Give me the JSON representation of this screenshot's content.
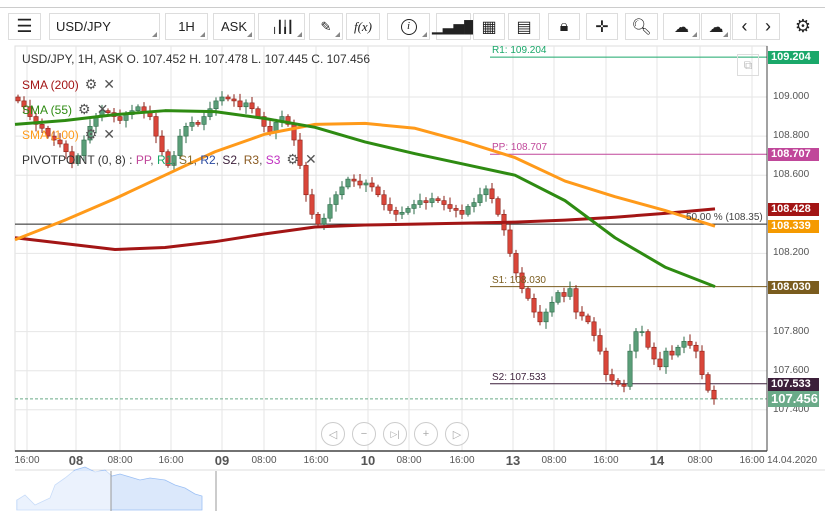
{
  "toolbar": {
    "symbol": "USD/JPY",
    "timeframe": "1H",
    "price_side": "ASK",
    "icons": [
      "menu-icon",
      "candlestick-icon",
      "pencil-icon",
      "function-icon",
      "info-icon",
      "bar-chart-icon",
      "calendar-icon",
      "news-icon",
      "lock-icon",
      "crosshair-icon",
      "zoom-chart-icon",
      "upload-icon",
      "download-icon",
      "chevron-left-icon",
      "chevron-right-icon",
      "gear-icon"
    ],
    "fx": "f(x)",
    "info": "i"
  },
  "legend": {
    "ohlc": "USD/JPY, 1H, ASK   O. 107.452 H. 107.478 L. 107.445 C. 107.456",
    "sma200": "SMA (200)",
    "sma55": "SMA (55)",
    "sma100": "SMA (100)",
    "pivot": "PIVOTPOINT (0, 8)",
    "pivot_sep": " : ",
    "pivot_items": [
      {
        "t": "PP",
        "c": "#c0479a"
      },
      {
        "t": ", ",
        "c": "#555"
      },
      {
        "t": "R1",
        "c": "#1aa86a"
      },
      {
        "t": ", ",
        "c": "#555"
      },
      {
        "t": "S1",
        "c": "#8a6d2a"
      },
      {
        "t": ", ",
        "c": "#555"
      },
      {
        "t": "R2",
        "c": "#2a4aa0"
      },
      {
        "t": ", ",
        "c": "#555"
      },
      {
        "t": "S2",
        "c": "#3c1f3a"
      },
      {
        "t": ", ",
        "c": "#555"
      },
      {
        "t": "R3",
        "c": "#8a5a20"
      },
      {
        "t": ", ",
        "c": "#555"
      },
      {
        "t": "S3",
        "c": "#c030c0"
      }
    ]
  },
  "chart_data": {
    "type": "candlestick",
    "y_ticks": [
      "109.000",
      "108.800",
      "108.600",
      "108.200",
      "107.800",
      "107.600",
      "107.400"
    ],
    "y_tick_values": [
      109.0,
      108.8,
      108.6,
      108.2,
      107.8,
      107.6,
      107.4
    ],
    "x_ticks": [
      {
        "t": "16:00",
        "d": false
      },
      {
        "t": "08",
        "d": true
      },
      {
        "t": "08:00",
        "d": false
      },
      {
        "t": "16:00",
        "d": false
      },
      {
        "t": "09",
        "d": true
      },
      {
        "t": "08:00",
        "d": false
      },
      {
        "t": "16:00",
        "d": false
      },
      {
        "t": "10",
        "d": true
      },
      {
        "t": "08:00",
        "d": false
      },
      {
        "t": "16:00",
        "d": false
      },
      {
        "t": "13",
        "d": true
      },
      {
        "t": "08:00",
        "d": false
      },
      {
        "t": "16:00",
        "d": false
      },
      {
        "t": "14",
        "d": true
      },
      {
        "t": "08:00",
        "d": false
      },
      {
        "t": "16:00",
        "d": false
      },
      {
        "t": "14.04.2020",
        "d": false
      }
    ],
    "closes": [
      108.98,
      108.95,
      108.9,
      108.86,
      108.84,
      108.8,
      108.78,
      108.76,
      108.72,
      108.66,
      108.7,
      108.78,
      108.85,
      108.9,
      108.93,
      108.92,
      108.9,
      108.88,
      108.91,
      108.93,
      108.95,
      108.92,
      108.9,
      108.8,
      108.72,
      108.65,
      108.7,
      108.8,
      108.85,
      108.87,
      108.86,
      108.9,
      108.94,
      108.98,
      109.0,
      108.99,
      108.98,
      108.95,
      108.97,
      108.94,
      108.9,
      108.85,
      108.82,
      108.87,
      108.9,
      108.86,
      108.78,
      108.65,
      108.5,
      108.4,
      108.35,
      108.38,
      108.45,
      108.5,
      108.54,
      108.58,
      108.57,
      108.55,
      108.56,
      108.54,
      108.5,
      108.45,
      108.42,
      108.4,
      108.41,
      108.43,
      108.45,
      108.47,
      108.46,
      108.48,
      108.47,
      108.45,
      108.43,
      108.42,
      108.4,
      108.44,
      108.46,
      108.5,
      108.53,
      108.48,
      108.4,
      108.32,
      108.2,
      108.1,
      108.02,
      107.97,
      107.9,
      107.85,
      107.9,
      107.95,
      108.0,
      107.98,
      108.02,
      107.9,
      107.88,
      107.85,
      107.78,
      107.7,
      107.58,
      107.55,
      107.53,
      107.52,
      107.7,
      107.8,
      107.8,
      107.72,
      107.66,
      107.62,
      107.7,
      107.68,
      107.72,
      107.75,
      107.73,
      107.7,
      107.58,
      107.5,
      107.456
    ],
    "sma200": [
      108.28,
      108.25,
      108.22,
      108.23,
      108.26,
      108.3,
      108.335,
      108.345,
      108.35,
      108.355,
      108.36,
      108.37,
      108.385,
      108.405,
      108.428
    ],
    "sma55": [
      108.86,
      108.88,
      108.91,
      108.93,
      108.925,
      108.89,
      108.845,
      108.77,
      108.71,
      108.655,
      108.6,
      108.47,
      108.28,
      108.13,
      108.03
    ],
    "sma100": [
      108.27,
      108.37,
      108.48,
      108.6,
      108.72,
      108.81,
      108.86,
      108.865,
      108.84,
      108.77,
      108.69,
      108.57,
      108.49,
      108.42,
      108.339
    ],
    "levels": [
      {
        "name": "R1",
        "label": "R1: 109.204",
        "value": 109.204,
        "box": "109.204",
        "color": "#1aa86a"
      },
      {
        "name": "PP",
        "label": "PP: 108.707",
        "value": 108.707,
        "box": "108.707",
        "color": "#c0479a"
      },
      {
        "name": "S1",
        "label": "S1: 108.030",
        "value": 108.03,
        "box": "108.030",
        "color": "#7a5c1e"
      },
      {
        "name": "S2",
        "label": "S2: 107.533",
        "value": 107.533,
        "box": "107.533",
        "color": "#3c1f3a"
      }
    ],
    "fib": {
      "label": "50.00 % (108.35)",
      "value": 108.35
    },
    "sma_boxes": [
      {
        "box": "108.428",
        "value": 108.428,
        "color": "#a31515"
      },
      {
        "box": "108.339",
        "value": 108.339,
        "color": "#f59a00"
      }
    ],
    "last": {
      "box": "107.456",
      "value": 107.456,
      "color": "#6aaa88"
    },
    "colors": {
      "up": "#5a9e78",
      "down": "#d9463a",
      "sma200": "#a31515",
      "sma55": "#2e8b12",
      "sma100": "#ff9a1a"
    }
  },
  "nav": {
    "prev": "◁",
    "zoom_out": "−",
    "end": "▷|",
    "zoom_in": "+",
    "next": "▷"
  }
}
